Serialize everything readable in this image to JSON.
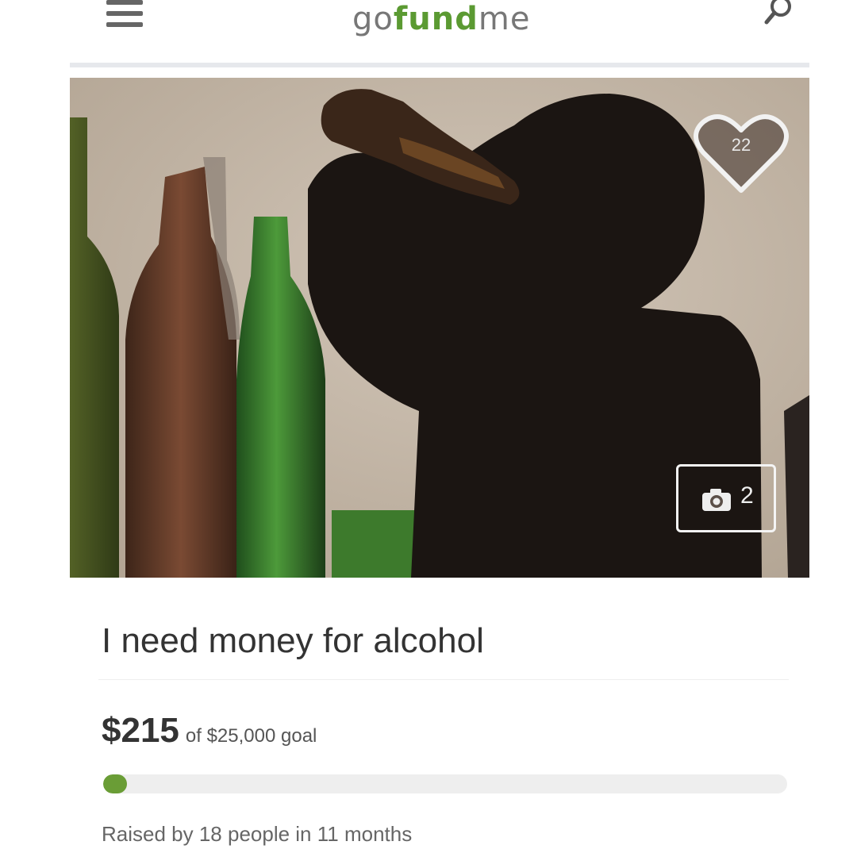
{
  "header": {
    "logo": {
      "part1": "go",
      "part2": "fund",
      "part3": "me"
    },
    "menu_icon": "hamburger-menu-icon",
    "search_icon": "search-icon"
  },
  "campaign": {
    "likes": "22",
    "photo_count": "2",
    "title": "I need money for alcohol",
    "amount_raised": "$215",
    "goal_text": "of $25,000 goal",
    "progress_fraction": 0.0086,
    "summary": "Raised by 18 people in 11 months"
  },
  "colors": {
    "brand_green": "#5b9a32",
    "progress_green": "#6a9d36"
  }
}
